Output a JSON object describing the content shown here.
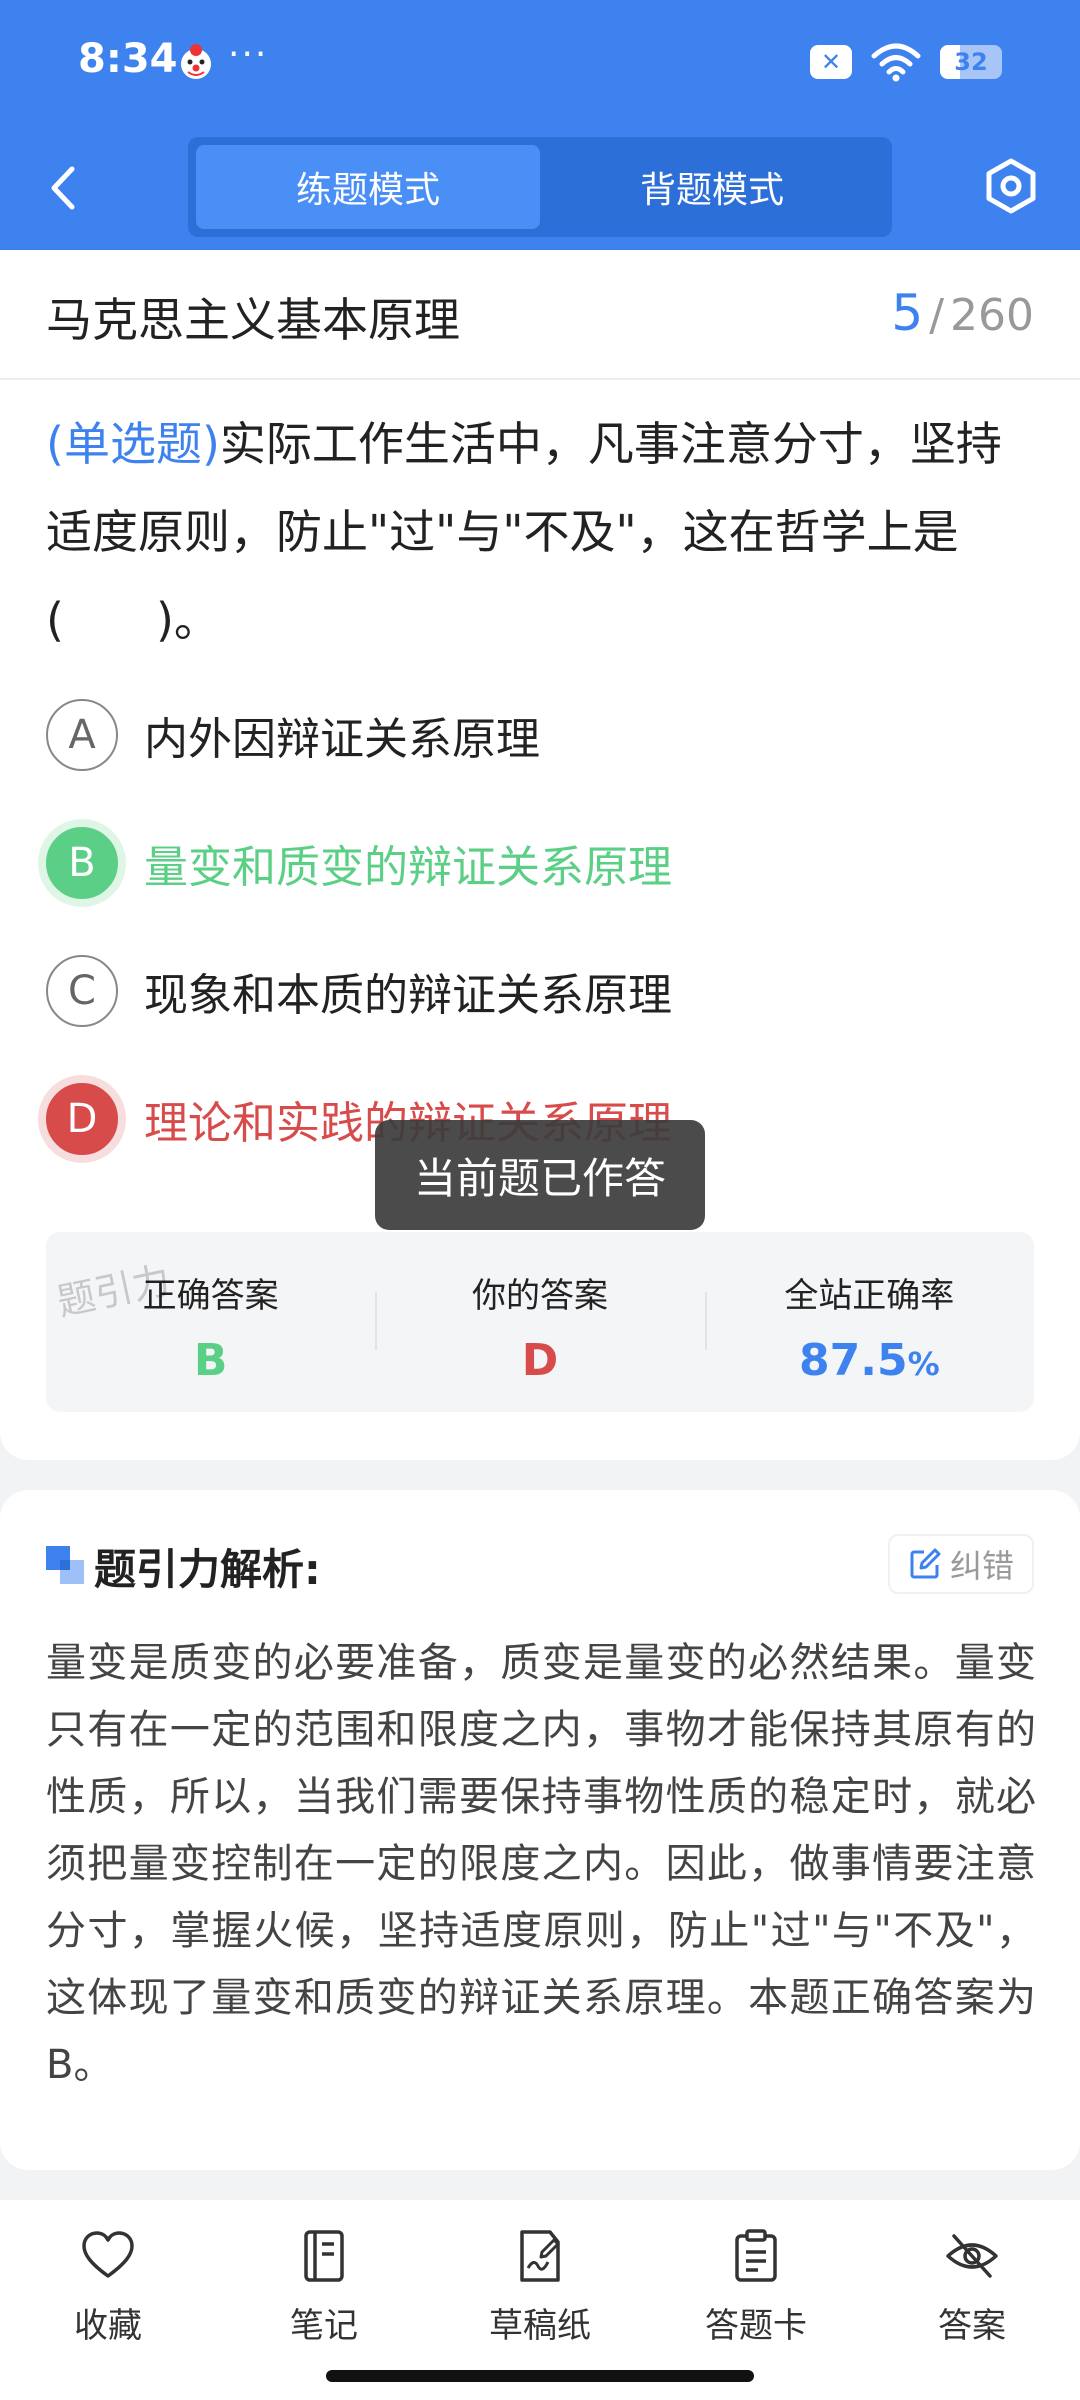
{
  "status": {
    "time": "8:34",
    "dots": "···",
    "battery": "32",
    "battery_level_pct": 32
  },
  "header": {
    "tabs": [
      {
        "label": "练题模式",
        "active": true
      },
      {
        "label": "背题模式",
        "active": false
      }
    ]
  },
  "subject": {
    "title": "马克思主义基本原理",
    "current": "5",
    "separator": "/",
    "total": "260"
  },
  "question": {
    "type": "(单选题)",
    "text": "实际工作生活中，凡事注意分寸，坚持适度原则，防止\"过\"与\"不及\"，这在哲学上是(　　)。"
  },
  "options": [
    {
      "letter": "A",
      "text": "内外因辩证关系原理",
      "state": "normal"
    },
    {
      "letter": "B",
      "text": "量变和质变的辩证关系原理",
      "state": "correct"
    },
    {
      "letter": "C",
      "text": "现象和本质的辩证关系原理",
      "state": "normal"
    },
    {
      "letter": "D",
      "text": "理论和实践的辩证关系原理",
      "state": "wrong"
    }
  ],
  "toast": "当前题已作答",
  "answer_summary": {
    "watermark": "题引力",
    "correct_label": "正确答案",
    "correct_value": "B",
    "yours_label": "你的答案",
    "yours_value": "D",
    "rate_label": "全站正确率",
    "rate_value": "87.5",
    "rate_unit": "%"
  },
  "analysis": {
    "title": "题引力解析:",
    "report_label": "纠错",
    "text": "量变是质变的必要准备，质变是量变的必然结果。量变只有在一定的范围和限度之内，事物才能保持其原有的性质，所以，当我们需要保持事物性质的稳定时，就必须把量变控制在一定的限度之内。因此，做事情要注意分寸，掌握火候，坚持适度原则，防止\"过\"与\"不及\"，这体现了量变和质变的辩证关系原理。本题正确答案为B。"
  },
  "toolbar": [
    {
      "label": "收藏",
      "icon": "heart-icon"
    },
    {
      "label": "笔记",
      "icon": "notebook-icon"
    },
    {
      "label": "草稿纸",
      "icon": "draft-icon"
    },
    {
      "label": "答题卡",
      "icon": "clipboard-icon"
    },
    {
      "label": "答案",
      "icon": "eye-off-icon"
    }
  ],
  "colors": {
    "brand": "#3d82ee",
    "correct": "#5ccf86",
    "wrong": "#d84b4b"
  }
}
